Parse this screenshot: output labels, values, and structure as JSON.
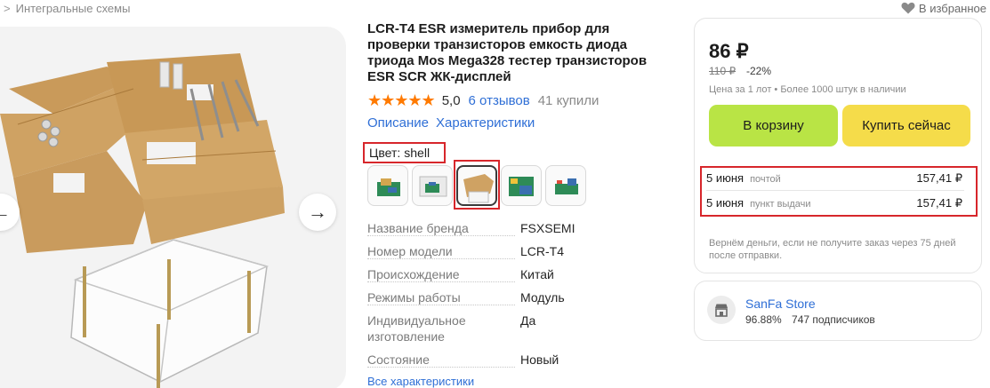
{
  "breadcrumb": {
    "separator": ">",
    "current": "Интегральные схемы"
  },
  "favorite": {
    "label": "В избранное",
    "icon": "heart-icon"
  },
  "gallery": {
    "prev_icon": "arrow-left-icon",
    "next_icon": "arrow-right-icon",
    "next_glyph": "→",
    "prev_glyph": "←"
  },
  "product": {
    "title": "LCR-T4 ESR измеритель прибор для проверки транзисторов емкость диода триода Mos Mega328 тестер транзисторов ESR SCR ЖК-дисплей",
    "stars": "★★★★★",
    "rating": "5,0",
    "reviews": "6 отзывов",
    "bought": "41 купили",
    "tabs": [
      "Описание",
      "Характеристики"
    ],
    "color_label": "Цвет:",
    "color_value": "shell",
    "swatch_count": 5,
    "selected_swatch": 3
  },
  "specs": [
    {
      "name": "Название бренда",
      "value": "FSXSEMI"
    },
    {
      "name": "Номер модели",
      "value": "LCR-T4"
    },
    {
      "name": "Происхождение",
      "value": "Китай"
    },
    {
      "name": "Режимы работы",
      "value": "Модуль"
    },
    {
      "name": "Индивидуальное изготовление",
      "value": "Да"
    },
    {
      "name": "Состояние",
      "value": "Новый"
    }
  ],
  "all_specs_link": "Все характеристики",
  "buy": {
    "price": "86 ₽",
    "old_price": "110 ₽",
    "discount": "-22%",
    "lot_info": "Цена за 1 лот • Более 1000 штук в наличии",
    "cart_button": "В корзину",
    "buy_now_button": "Купить сейчас",
    "accent_cart": "#b9e445",
    "accent_buy": "#f5dc4a",
    "delivery": [
      {
        "date": "5 июня",
        "method": "почтой",
        "cost": "157,41 ₽"
      },
      {
        "date": "5 июня",
        "method": "пункт выдачи",
        "cost": "157,41 ₽"
      }
    ],
    "refund": "Вернём деньги, если не получите заказ через 75 дней после отправки."
  },
  "store": {
    "name": "SanFa Store",
    "rating": "96.88%",
    "followers": "747 подписчиков",
    "icon": "store-icon"
  },
  "colors": {
    "link": "#2f6fd6",
    "highlight": "#d7262b",
    "star": "#ff7a00"
  }
}
